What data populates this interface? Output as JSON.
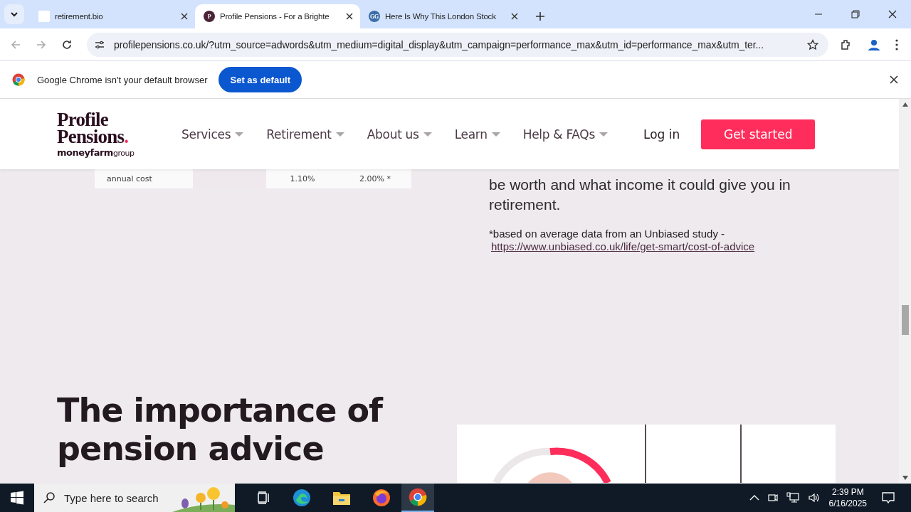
{
  "browser": {
    "tabs": [
      {
        "title": "retirement.bio",
        "selected": false
      },
      {
        "title": "Profile Pensions - For a Brighte",
        "selected": true,
        "favicon_text": "P",
        "color": "#4a2337"
      },
      {
        "title": "Here Is Why This London Stock",
        "selected": false,
        "favicon_text": "GG",
        "color": "#3b6ea8"
      }
    ],
    "address": "profilepensions.co.uk/?utm_source=adwords&utm_medium=digital_display&utm_campaign=performance_max&utm_id=performance_max&utm_ter..."
  },
  "infobar": {
    "message": "Google Chrome isn't your default browser",
    "button": "Set as default"
  },
  "site_header": {
    "logo": {
      "line_1": "Profile",
      "line_2": "Pensions",
      "dot": ".",
      "brand": "moneyfarm",
      "brand_suffix": "group"
    },
    "nav": [
      "Services",
      "Retirement",
      "About us",
      "Learn",
      "Help & FAQs"
    ],
    "login": "Log in",
    "cta": "Get started"
  },
  "table_row": {
    "label": "annual cost",
    "values": [
      "1.10%",
      "2.00% *"
    ]
  },
  "paragraph": "be worth and what income it could give you in retirement.",
  "footnote": {
    "text": "*based on average data from an Unbiased study -",
    "link": "https://www.unbiased.co.uk/life/get-smart/cost-of-advice"
  },
  "heading": "The importance of pension advice",
  "taskbar": {
    "search_placeholder": "Type here to search",
    "time": "2:39 PM",
    "date": "6/16/2025"
  }
}
